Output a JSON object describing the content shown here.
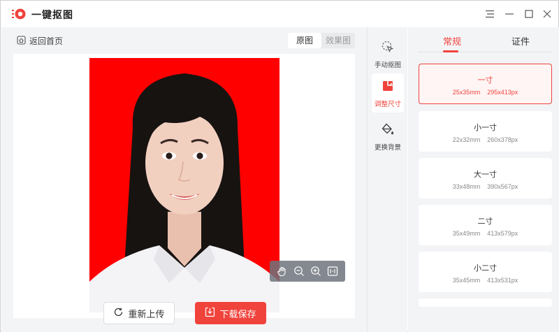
{
  "app": {
    "title": "一键抠图"
  },
  "left": {
    "back_label": "返回首页",
    "view_toggle": [
      {
        "label": "原图",
        "active": true
      },
      {
        "label": "效果图",
        "active": false
      }
    ],
    "buttons": {
      "reupload": "重新上传",
      "download": "下载保存"
    },
    "zoom_tools": [
      "hand-icon",
      "zoom-out-icon",
      "zoom-in-icon",
      "fit-screen-icon"
    ]
  },
  "tools": [
    {
      "label": "手动抠图",
      "icon": "manual-cutout-icon",
      "active": false
    },
    {
      "label": "调整尺寸",
      "icon": "resize-icon",
      "active": true
    },
    {
      "label": "更换背景",
      "icon": "paint-bucket-icon",
      "active": false
    }
  ],
  "right": {
    "tabs": [
      {
        "label": "常规",
        "active": true
      },
      {
        "label": "证件",
        "active": false
      }
    ],
    "sizes": [
      {
        "name": "一寸",
        "mm": "25x35mm",
        "px": "295x413px",
        "active": true
      },
      {
        "name": "小一寸",
        "mm": "22x32mm",
        "px": "260x378px",
        "active": false
      },
      {
        "name": "大一寸",
        "mm": "33x48mm",
        "px": "390x567px",
        "active": false
      },
      {
        "name": "二寸",
        "mm": "35x49mm",
        "px": "413x579px",
        "active": false
      },
      {
        "name": "小二寸",
        "mm": "35x45mm",
        "px": "413x531px",
        "active": false
      }
    ]
  },
  "colors": {
    "accent": "#f0433c",
    "photo_background": "#ff0000",
    "panel": "#f3f4f6"
  }
}
